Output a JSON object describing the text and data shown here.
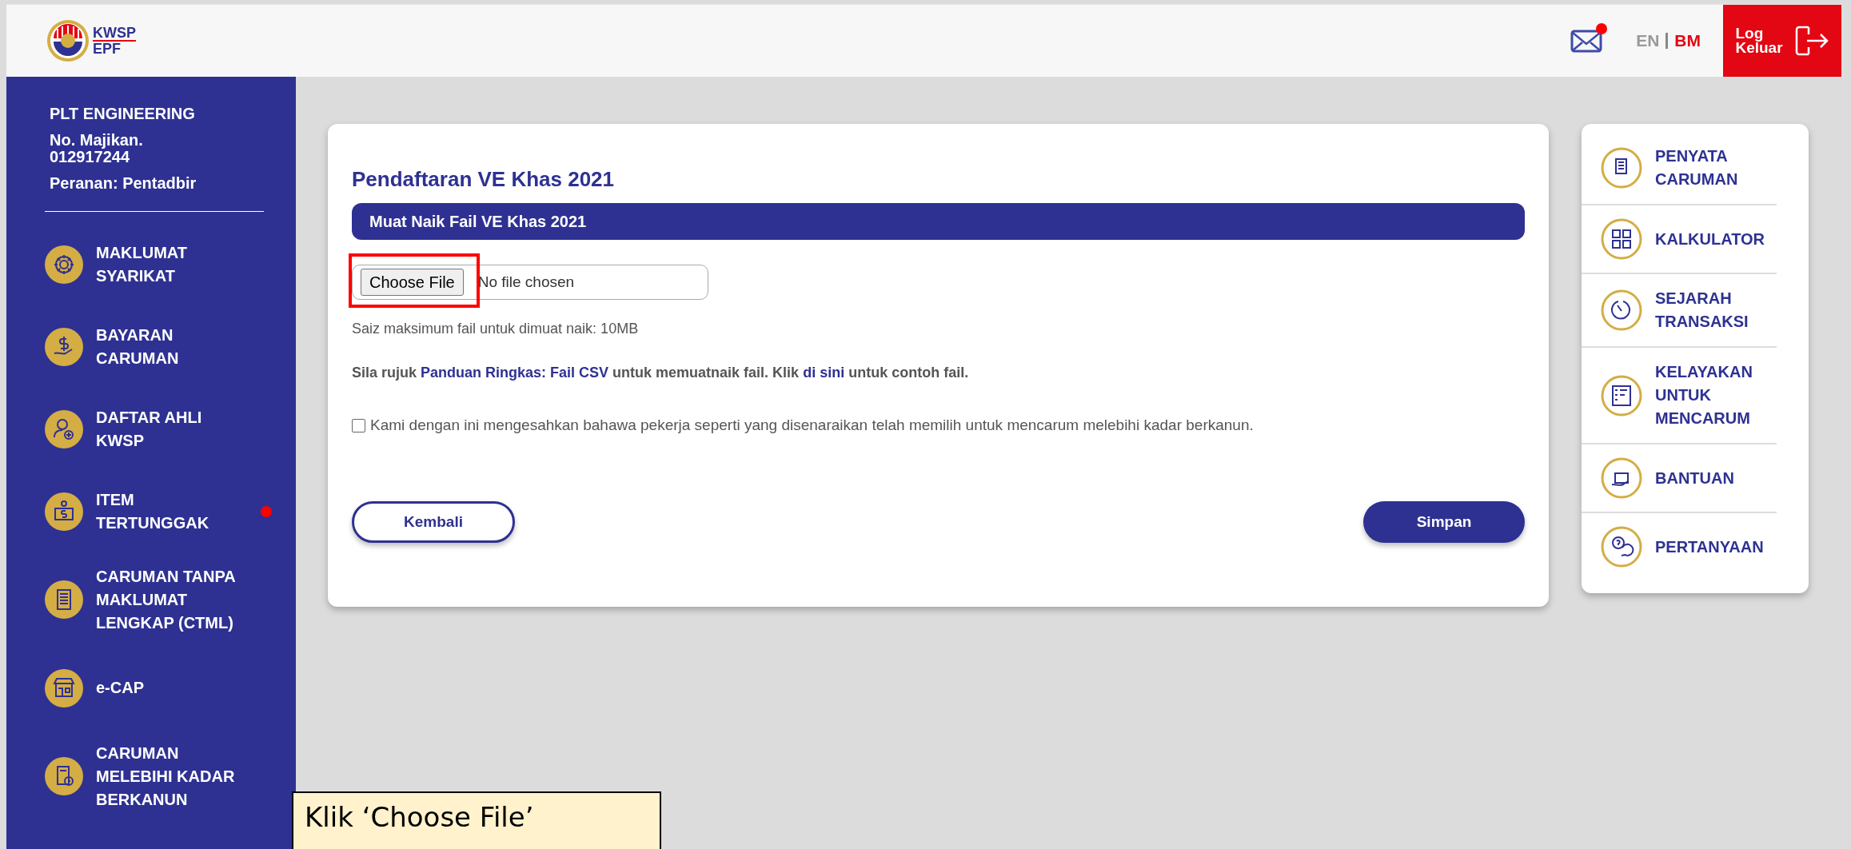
{
  "header": {
    "logo": {
      "line1": "KWSP",
      "line2": "EPF"
    },
    "mail": {
      "unread": true
    },
    "languages": [
      {
        "label": "EN",
        "selected": false
      },
      {
        "label": "BM",
        "selected": true
      }
    ],
    "logout": "Log\nKeluar"
  },
  "sidebar": {
    "company": "PLT ENGINEERING",
    "employer_no": "No. Majikan.\n012917244",
    "role": "Peranan: Pentadbir",
    "items": [
      {
        "label": "MAKLUMAT\nSYARIKAT",
        "kind": "gear",
        "badge": false
      },
      {
        "label": "BAYARAN\nCARUMAN",
        "kind": "payment",
        "badge": false
      },
      {
        "label": "DAFTAR AHLI\nKWSP",
        "kind": "user-add",
        "badge": false
      },
      {
        "label": "ITEM\nTERTUNGGAK",
        "kind": "bag",
        "badge": true
      },
      {
        "label": "CARUMAN TANPA\nMAKLUMAT\nLENGKAP (CTML)",
        "kind": "document",
        "badge": false
      },
      {
        "label": "e-CAP",
        "kind": "shop",
        "badge": false
      },
      {
        "label": "CARUMAN\nMELEBIHI KADAR\nBERKANUN",
        "kind": "clock-doc",
        "badge": false
      }
    ]
  },
  "form": {
    "title": "Pendaftaran VE Khas 2021",
    "section": "Muat Naik Fail VE Khas 2021",
    "file_input": {
      "button": "Choose File",
      "value": "No file chosen"
    },
    "size_note": "Saiz maksimum fail untuk dimuat naik: 10MB",
    "guide": [
      {
        "kind": "text",
        "text": "Sila rujuk "
      },
      {
        "kind": "link",
        "text": "Panduan Ringkas: Fail CSV"
      },
      {
        "kind": "text",
        "text": " untuk memuatnaik fail. Klik "
      },
      {
        "kind": "link",
        "text": "di sini"
      },
      {
        "kind": "text",
        "text": " untuk contoh fail."
      }
    ],
    "confirm": {
      "label": "Kami dengan ini mengesahkan bahawa pekerja seperti yang disenaraikan telah memilih untuk mencarum melebihi kadar berkanun.",
      "checked": false
    },
    "back": "Kembali",
    "save": "Simpan"
  },
  "quick_links": [
    {
      "label": "PENYATA\nCARUMAN",
      "kind": "statement"
    },
    {
      "label": "KALKULATOR",
      "kind": "calculator"
    },
    {
      "label": "SEJARAH\nTRANSAKSI",
      "kind": "history"
    },
    {
      "label": "KELAYAKAN\nUNTUK\nMENCARUM",
      "kind": "checklist"
    },
    {
      "label": "BANTUAN",
      "kind": "help"
    },
    {
      "label": "PERTANYAAN",
      "kind": "question"
    }
  ],
  "callout": "Klik ‘Choose File’"
}
